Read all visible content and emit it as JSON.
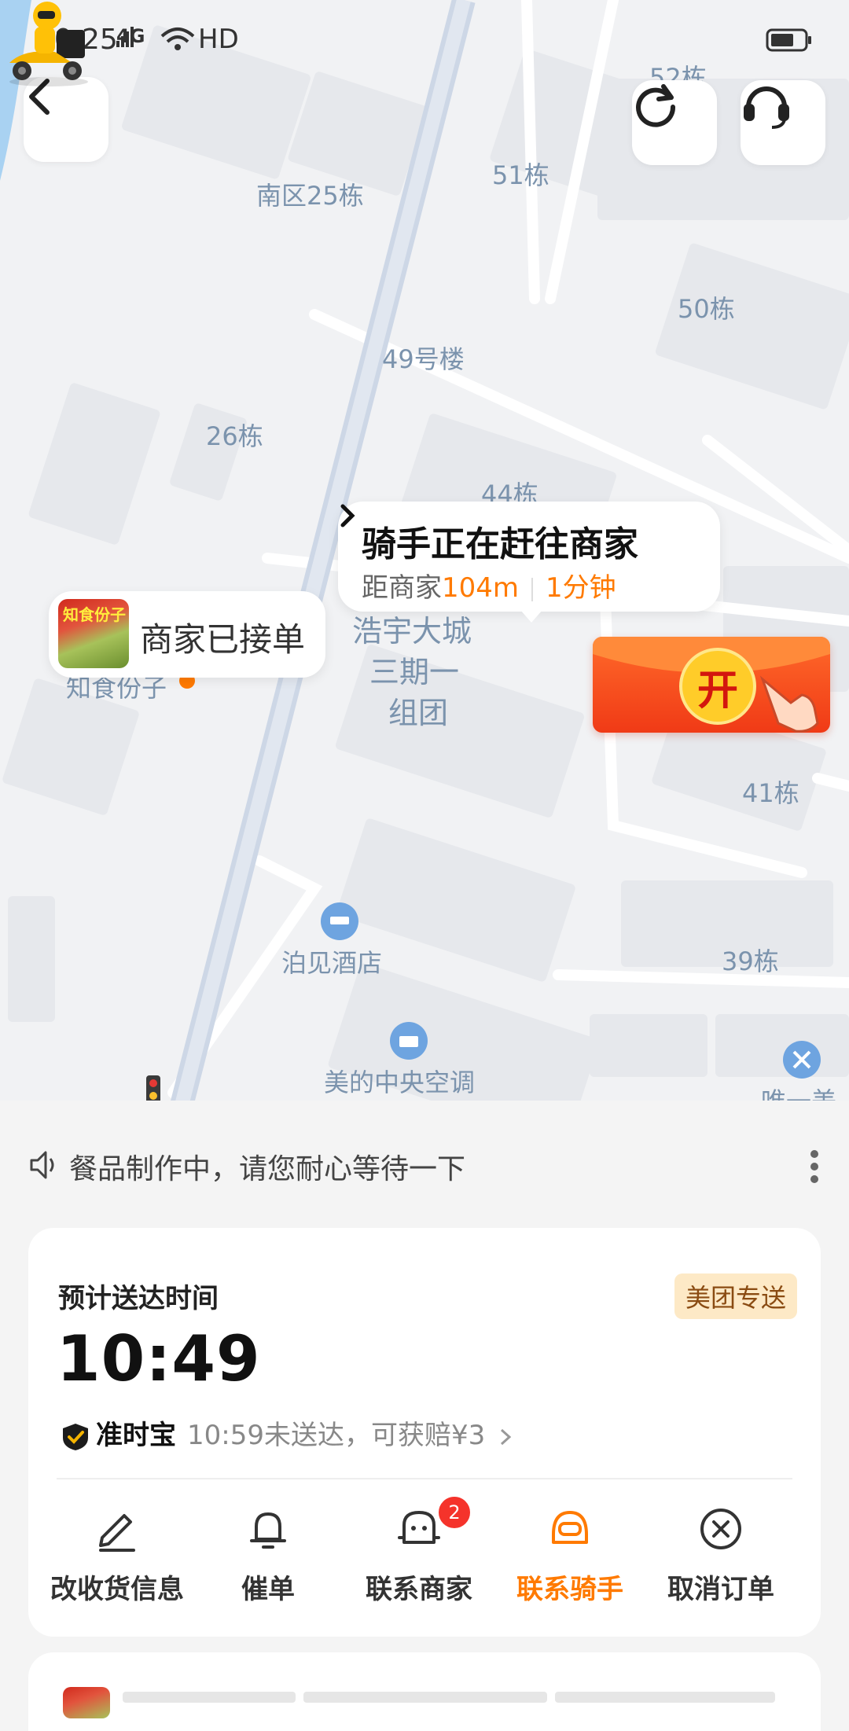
{
  "status_bar": {
    "time": "10:25",
    "signal": "4G",
    "hd": "HD"
  },
  "map": {
    "labels": [
      "52栋",
      "南区25栋",
      "51栋",
      "50栋",
      "49号楼",
      "26栋",
      "44栋",
      "浩宇大城",
      "三期一",
      "组团",
      "知食份子",
      "41栋",
      "泊见酒店",
      "39栋",
      "美的中央空调",
      "唯一美"
    ],
    "shop_thumb_text": "知食份子"
  },
  "rider_bubble": {
    "title": "骑手正在赶往商家",
    "distance_prefix": "距商家",
    "distance": "104m",
    "eta": "1分钟"
  },
  "shop_bubble": {
    "text": "商家已接单"
  },
  "red_packet": {
    "label": "开"
  },
  "notice": {
    "text": "餐品制作中，请您耐心等待一下"
  },
  "delivery_card": {
    "label": "预计送达时间",
    "tag": "美团专送",
    "time": "10:49",
    "guarantee_name": "准时宝",
    "guarantee_desc": "10:59未送达，可获赔¥3"
  },
  "actions": [
    {
      "label": "改收货信息",
      "icon": "edit-icon"
    },
    {
      "label": "催单",
      "icon": "bell-icon"
    },
    {
      "label": "联系商家",
      "icon": "merchant-icon",
      "badge": "2"
    },
    {
      "label": "联系骑手",
      "icon": "rider-icon",
      "active": true
    },
    {
      "label": "取消订单",
      "icon": "cancel-icon"
    }
  ],
  "colors": {
    "accent": "#ff7a00",
    "badge": "#f5332b",
    "tag_bg": "#fde9c6"
  }
}
